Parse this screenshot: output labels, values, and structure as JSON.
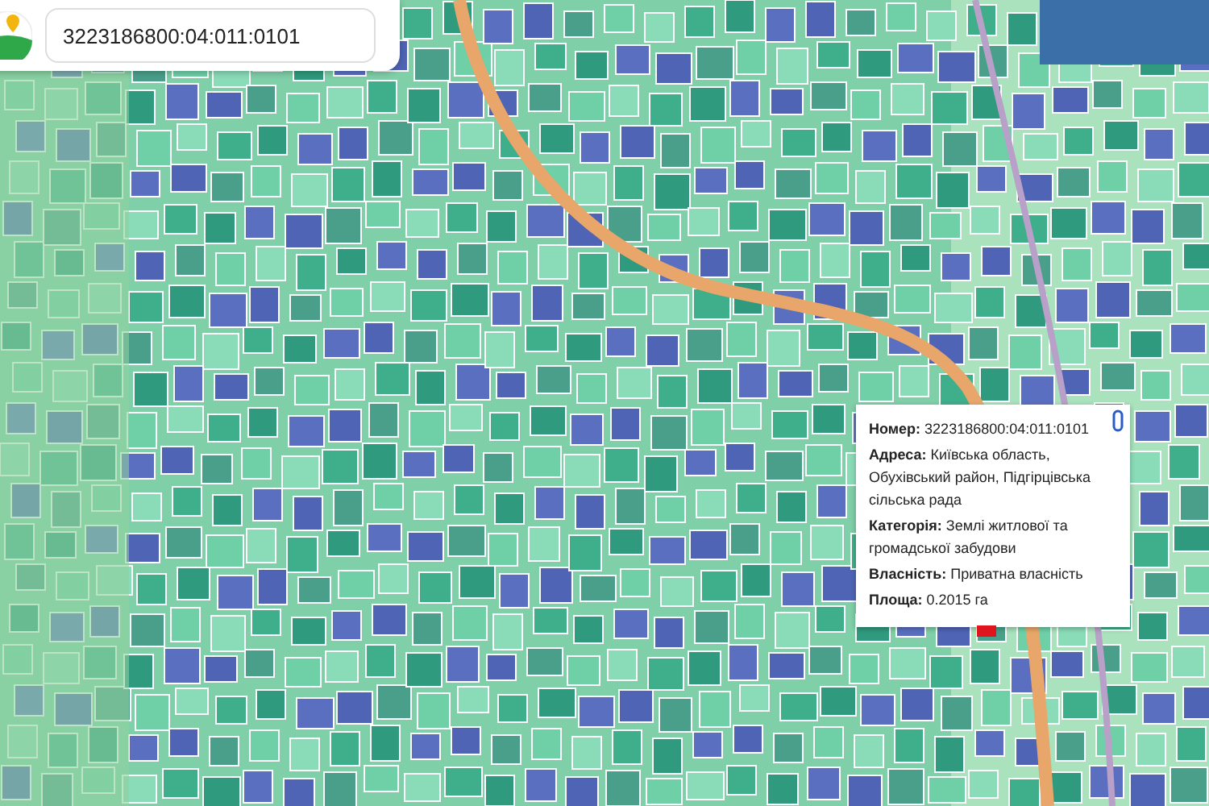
{
  "search": {
    "value": "3223186800:04:011:0101"
  },
  "popup": {
    "lines": [
      "**Номер:** 3223186800:04:011:0101",
      "**Адреса:** Київська область, Обухівський район, Підгірцівська сільська рада",
      "**Категорія:** Землі житлової та громадської забудови",
      "**Власність:** Приватна власність",
      "**Площа:** 0.2015 га"
    ]
  }
}
